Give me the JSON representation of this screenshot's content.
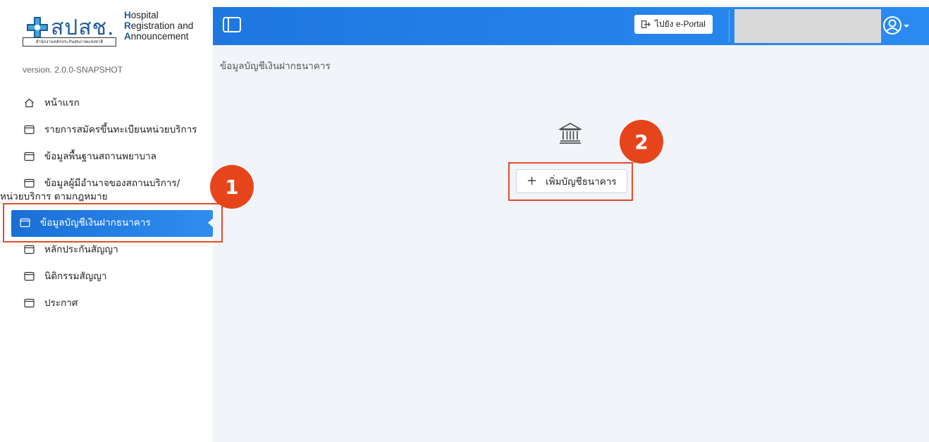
{
  "logo": {
    "thai_name": "สปสช.",
    "thai_subtitle": "สำนักงานหลักประกันสุขภาพแห่งชาติ",
    "eng_line1_initial": "H",
    "eng_line1_rest": "ospital",
    "eng_line2_initial": "R",
    "eng_line2_rest": "egistration and",
    "eng_line3_initial": "A",
    "eng_line3_rest": "nnouncement"
  },
  "version": "version. 2.0.0-SNAPSHOT",
  "sidebar": {
    "items": [
      {
        "label": "หน้าแรก",
        "icon": "home-icon"
      },
      {
        "label": "รายการสมัครขึ้นทะเบียนหน่วยบริการ",
        "icon": "window-icon"
      },
      {
        "label": "ข้อมูลพื้นฐานสถานพยาบาล",
        "icon": "window-icon"
      },
      {
        "label_line1": "ข้อมูลผู้มีอำนาจของสถานบริการ/",
        "label_line2": "หน่วยบริการ ตามกฎหมาย",
        "icon": "window-icon"
      },
      {
        "label": "ข้อมูลบัญชีเงินฝากธนาคาร",
        "icon": "window-icon",
        "active": true
      },
      {
        "label": "หลักประกันสัญญา",
        "icon": "window-icon"
      },
      {
        "label": "นิติกรรมสัญญา",
        "icon": "window-icon"
      },
      {
        "label": "ประกาศ",
        "icon": "window-icon"
      }
    ]
  },
  "header": {
    "eportal_label": "ไปยัง e-Portal"
  },
  "main": {
    "page_title": "ข้อมูลบัญชีเงินฝากธนาคาร",
    "add_button_label": "เพิ่มบัญชีธนาคาร"
  },
  "annotations": {
    "step1": "1",
    "step2": "2",
    "color": "#e6451c"
  },
  "colors": {
    "header": "#1e77e0",
    "active_item": "#1a6fd6",
    "main_bg": "#f1f4f8"
  }
}
